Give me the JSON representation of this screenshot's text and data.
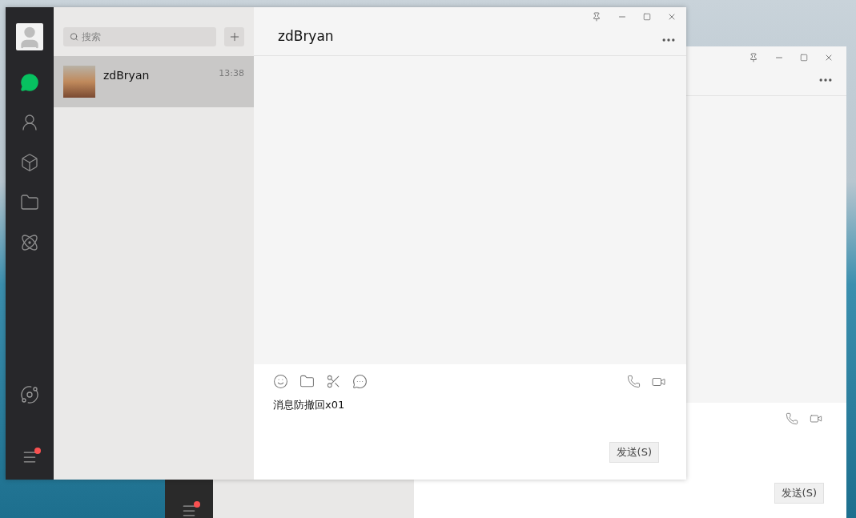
{
  "back_window": {
    "sidebar": {
      "menu": {
        "unread": true
      }
    },
    "send_button": "发送(S)"
  },
  "main_window": {
    "sidebar": {
      "nav": [
        {
          "kind": "chats",
          "selected": true
        },
        {
          "kind": "contacts",
          "selected": false
        },
        {
          "kind": "favorites",
          "selected": false
        },
        {
          "kind": "files",
          "selected": false
        },
        {
          "kind": "moments",
          "selected": false
        }
      ],
      "mini_programs": {
        "kind": "mini_programs"
      },
      "menu": {
        "unread": true
      }
    },
    "search": {
      "placeholder": "搜索"
    },
    "chats": [
      {
        "name": "zdBryan",
        "time": "13:38",
        "selected": true
      }
    ],
    "chat": {
      "title": "zdBryan",
      "input": "消息防撤回x01",
      "send_button": "发送(S)"
    }
  }
}
